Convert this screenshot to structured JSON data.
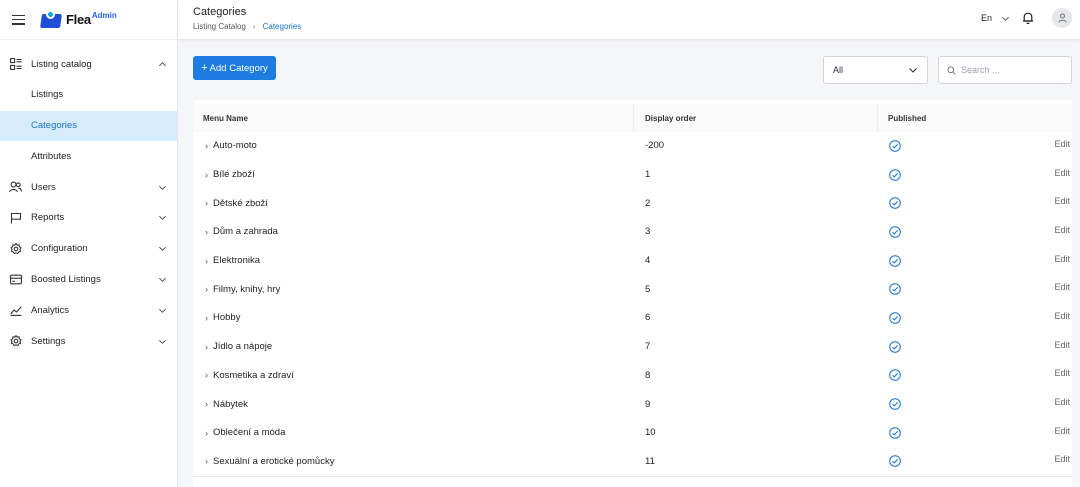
{
  "app": {
    "logo_text": "Flea",
    "logo_sub": "Admin"
  },
  "header": {
    "title": "Categories",
    "breadcrumb": [
      "Listing Catalog",
      "Categories"
    ],
    "language": "En"
  },
  "sidebar": {
    "items": [
      {
        "label": "Listing catalog",
        "icon": "grid-list-icon",
        "expanded": true
      },
      {
        "label": "Listings"
      },
      {
        "label": "Categories",
        "active": true
      },
      {
        "label": "Attributes"
      },
      {
        "label": "Users",
        "icon": "users-icon"
      },
      {
        "label": "Reports",
        "icon": "flag-icon"
      },
      {
        "label": "Configuration",
        "icon": "gear-icon"
      },
      {
        "label": "Boosted Listings",
        "icon": "card-icon"
      },
      {
        "label": "Analytics",
        "icon": "chart-line-icon"
      },
      {
        "label": "Settings",
        "icon": "settings-icon"
      }
    ]
  },
  "toolbar": {
    "add_label": "Add Category",
    "filter_value": "All",
    "search_placeholder": "Search ..."
  },
  "table": {
    "columns": [
      "Menu Name",
      "Display order",
      "Published"
    ],
    "edit_label": "Edit",
    "rows": [
      {
        "name": "Auto-moto",
        "order": "-200",
        "published": true
      },
      {
        "name": "Bílé zboží",
        "order": "1",
        "published": true
      },
      {
        "name": "Dětské zboží",
        "order": "2",
        "published": true
      },
      {
        "name": "Dům a zahrada",
        "order": "3",
        "published": true
      },
      {
        "name": "Elektronika",
        "order": "4",
        "published": true
      },
      {
        "name": "Filmy, knihy, hry",
        "order": "5",
        "published": true
      },
      {
        "name": "Hobby",
        "order": "6",
        "published": true
      },
      {
        "name": "Jídlo a nápoje",
        "order": "7",
        "published": true
      },
      {
        "name": "Kosmetika a zdraví",
        "order": "8",
        "published": true
      },
      {
        "name": "Nábytek",
        "order": "9",
        "published": true
      },
      {
        "name": "Oblečení a móda",
        "order": "10",
        "published": true
      },
      {
        "name": "Sexuální a erotické pomůcky",
        "order": "11",
        "published": true
      }
    ]
  },
  "colors": {
    "accent": "#1e7be0",
    "active_bg": "#d6ebfb",
    "check": "#1a73c8"
  }
}
